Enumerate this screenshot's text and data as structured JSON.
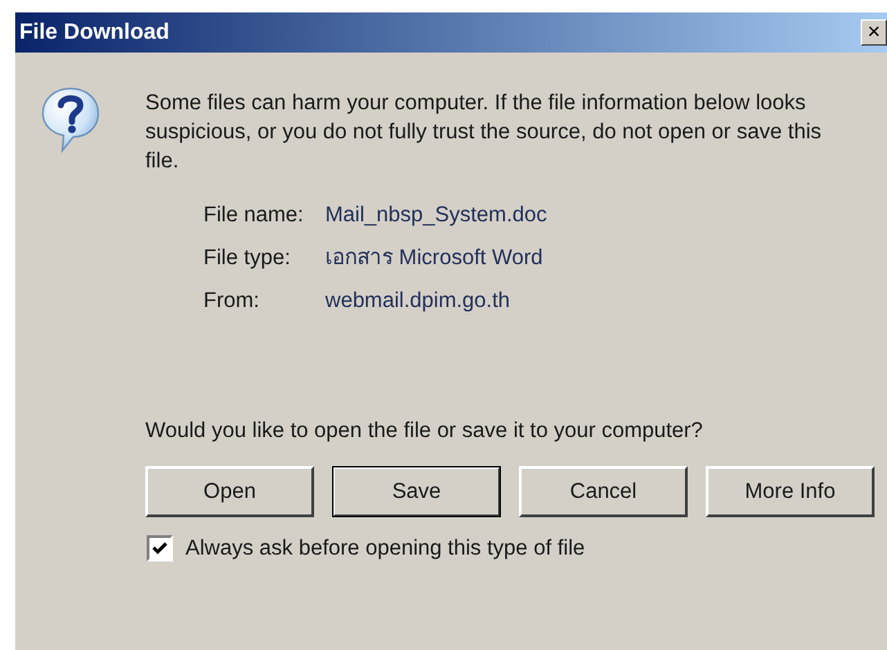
{
  "window": {
    "title": "File Download",
    "close": "×"
  },
  "warning": "Some files can harm your computer. If the file information below looks suspicious, or you do not fully trust the source, do not open or save this file.",
  "file_info": [
    {
      "label": "File name:",
      "value": "Mail_nbsp_System.doc"
    },
    {
      "label": "File type:",
      "value": "เอกสาร Microsoft Word"
    },
    {
      "label": "From:",
      "value": "webmail.dpim.go.th"
    }
  ],
  "question": "Would you like to open the file or save it to your computer?",
  "buttons": [
    {
      "label": "Open",
      "default": false
    },
    {
      "label": "Save",
      "default": true
    },
    {
      "label": "Cancel",
      "default": false
    },
    {
      "label": "More Info",
      "default": false
    }
  ],
  "checkbox": {
    "label": "Always ask before opening this type of file",
    "checked": true
  }
}
